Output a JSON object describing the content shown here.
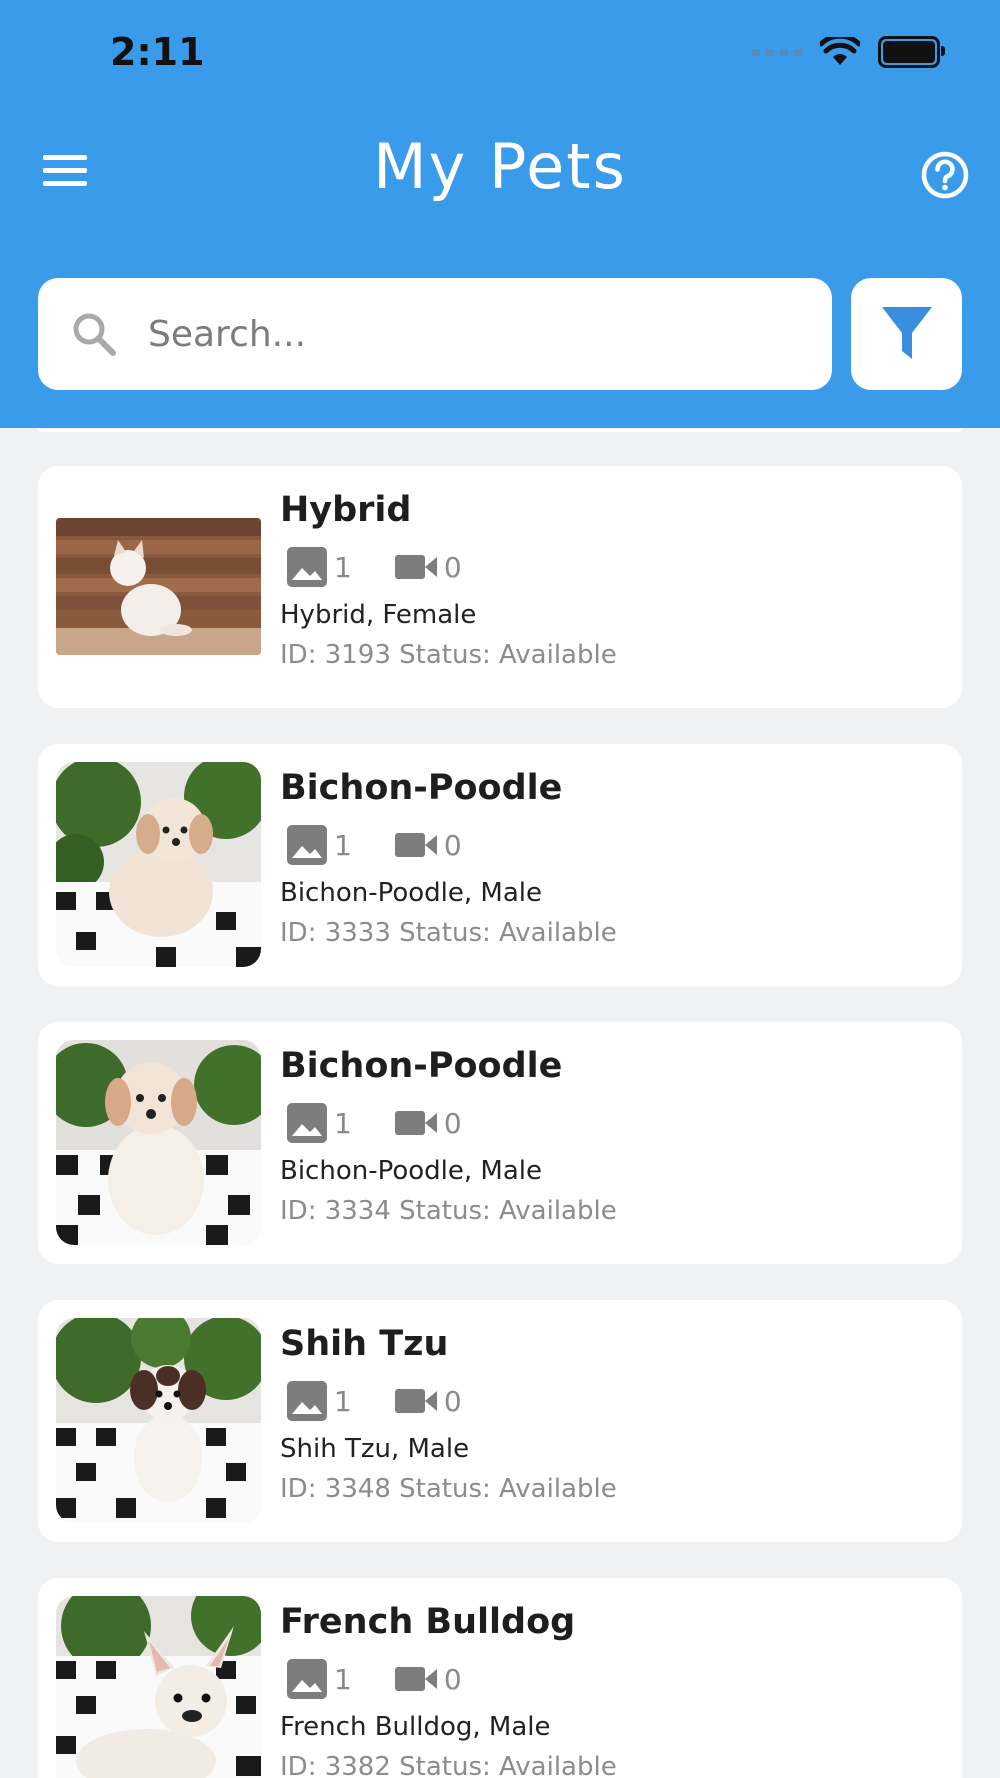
{
  "status_bar": {
    "time": "2:11"
  },
  "header": {
    "title": "My Pets"
  },
  "search": {
    "placeholder": "Search..."
  },
  "colors": {
    "header_bg": "#3a9bea",
    "page_bg": "#f0f1f3",
    "filter_icon": "#3a8ee0"
  },
  "pets": [
    {
      "name": "Hybrid",
      "photos": "1",
      "videos": "0",
      "breed_sex": "Hybrid, Female",
      "meta": "ID: 3193 Status: Available",
      "image": "kitten-photo"
    },
    {
      "name": "Bichon-Poodle",
      "photos": "1",
      "videos": "0",
      "breed_sex": "Bichon-Poodle, Male",
      "meta": "ID: 3333 Status: Available",
      "image": "puppy-photo"
    },
    {
      "name": "Bichon-Poodle",
      "photos": "1",
      "videos": "0",
      "breed_sex": "Bichon-Poodle, Male",
      "meta": "ID: 3334 Status: Available",
      "image": "puppy-photo"
    },
    {
      "name": "Shih Tzu",
      "photos": "1",
      "videos": "0",
      "breed_sex": "Shih Tzu, Male",
      "meta": "ID: 3348 Status: Available",
      "image": "puppy-photo"
    },
    {
      "name": "French Bulldog",
      "photos": "1",
      "videos": "0",
      "breed_sex": "French Bulldog, Male",
      "meta": "ID: 3382 Status: Available",
      "image": "puppy-photo"
    }
  ]
}
